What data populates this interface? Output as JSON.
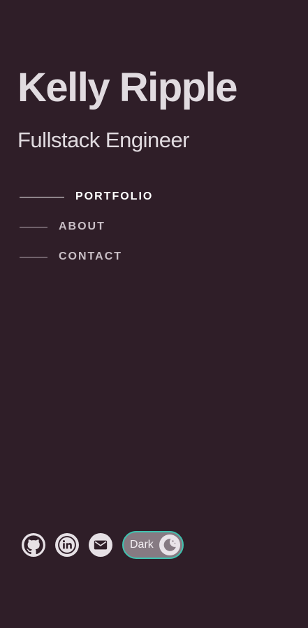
{
  "header": {
    "name": "Kelly Ripple",
    "role": "Fullstack Engineer"
  },
  "nav": {
    "items": [
      {
        "label": "PORTFOLIO",
        "active": true
      },
      {
        "label": "ABOUT",
        "active": false
      },
      {
        "label": "CONTACT",
        "active": false
      }
    ]
  },
  "socials": [
    {
      "icon": "github-icon"
    },
    {
      "icon": "linkedin-icon"
    },
    {
      "icon": "mail-icon"
    }
  ],
  "theme_toggle": {
    "label": "Dark",
    "icon": "moon-icon"
  },
  "colors": {
    "background": "#2f1e28",
    "text": "#e1dbe0",
    "toggle_border": "#3fc3b0",
    "toggle_fill": "#867a82"
  }
}
